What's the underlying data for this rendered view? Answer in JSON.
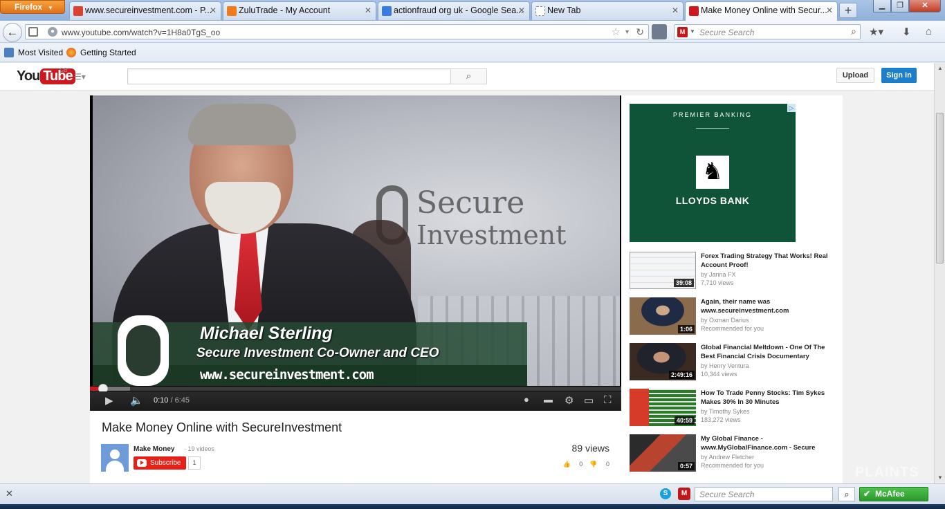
{
  "browser": {
    "menu_label": "Firefox",
    "tabs": [
      {
        "title": "www.secureinvestment.com - P...",
        "favicon_color": "#d9432f"
      },
      {
        "title": "ZuluTrade - My Account",
        "favicon_color": "#f07b1f"
      },
      {
        "title": "actionfraud org uk - Google Sea...",
        "favicon_color": "#3a7be0"
      },
      {
        "title": "New Tab",
        "favicon_color": "#ffffff"
      },
      {
        "title": "Make Money Online with Secur...",
        "favicon_color": "#cc181e",
        "active": true
      }
    ],
    "url": "www.youtube.com/watch?v=1H8a0TgS_oo",
    "search_placeholder": "Secure Search",
    "bookmarks": [
      "Most Visited",
      "Getting Started"
    ]
  },
  "youtube": {
    "logo_you": "You",
    "logo_tube": "Tube",
    "region": "GB",
    "upload_label": "Upload",
    "signin_label": "Sign in",
    "video": {
      "overlay_name": "Michael Sterling",
      "overlay_role": "Secure Investment Co-Owner and CEO",
      "overlay_url": "www.secureinvestment.com",
      "wall_word1": "Secure",
      "wall_word2": "Investment",
      "current_time": "0:10",
      "duration": "6:45",
      "played_fraction": 0.025,
      "loaded_fraction": 0.075
    },
    "title": "Make Money Online with SecureInvestment",
    "channel": {
      "name": "Make Money",
      "videos": "· 19 videos",
      "subscribe_label": "Subscribe",
      "subscriber_count": "1"
    },
    "views": "89 views",
    "likes": "0",
    "dislikes": "0",
    "ad": {
      "tagline": "PREMIER BANKING",
      "brand": "LLOYDS BANK",
      "color": "#0f5438"
    },
    "related": [
      {
        "title": "Forex Trading Strategy That Works! Real Account Proof!",
        "by": "by Janna FX",
        "meta": "7,710 views",
        "duration": "39:08"
      },
      {
        "title": "Again, their name was www.secureinvestment.com",
        "by": "by Oxman Darius",
        "meta": "Recommended for you",
        "duration": "1:06"
      },
      {
        "title": "Global Financial Meltdown - One Of The Best Financial Crisis Documentary",
        "by": "by Henry Ventura",
        "meta": "10,344 views",
        "duration": "2:49:16"
      },
      {
        "title": "How To Trade Penny Stocks: Tim Sykes Makes 30% In 30 Minutes",
        "by": "by Timothy Sykes",
        "meta": "183,272 views",
        "duration": "40:59"
      },
      {
        "title": "My Global Finance - www.MyGlobalFinance.com - Secure",
        "by": "by Andrew Fletcher",
        "meta": "Recommended for you",
        "duration": "0:57"
      }
    ]
  },
  "statusbar": {
    "search_placeholder": "Secure Search",
    "mcafee_label": "McAfee"
  },
  "watermark": "PLAINTS"
}
